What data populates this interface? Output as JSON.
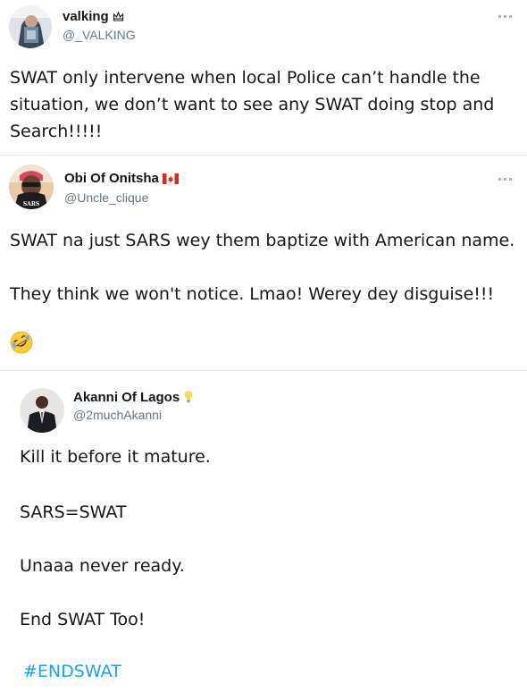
{
  "tweets": [
    {
      "name": "valking",
      "badge_icon": "crown-outline-icon",
      "handle": "@_VALKING",
      "text": "SWAT only intervene when local Police can’t handle the situation, we don’t want to see any SWAT doing stop and Search!!!!!"
    },
    {
      "name": "Obi Of Onitsha",
      "badge_icon": "canada-flag-icon",
      "handle": "@Uncle_clique",
      "text": "SWAT na just SARS wey them baptize with American name.\n\nThey think we won't notice. Lmao! Werey dey disguise!!!",
      "emoji": "rolling-on-floor-laughing-emoji",
      "avatar_text": "SARS"
    },
    {
      "name": "Akanni Of Lagos",
      "badge_icon": "lightbulb-icon",
      "handle": "@2muchAkanni",
      "paragraphs": [
        "Kill it before it mature.",
        "SARS=SWAT",
        "Unaaa never ready.",
        "End SWAT Too!"
      ],
      "hashtag": "#ENDSWAT"
    }
  ],
  "colors": {
    "text": "#14171a",
    "secondary": "#657786",
    "link": "#1da1f2",
    "divider": "#e1e8ed"
  }
}
